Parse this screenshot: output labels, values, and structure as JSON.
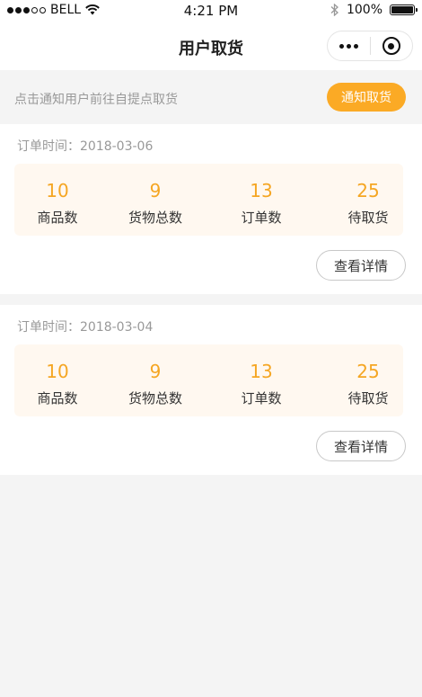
{
  "status_bar": {
    "carrier": "BELL",
    "time": "4:21 PM",
    "battery": "100%",
    "signal_bars": 3,
    "signal_total": 5
  },
  "nav": {
    "title": "用户取货",
    "more_icon": "more-dots-icon",
    "close_icon": "target-icon"
  },
  "notify": {
    "tip": "点击通知用户前往自提点取货",
    "button_label": "通知取货",
    "accent_color": "#fbaa25"
  },
  "orders": [
    {
      "date_label": "订单时间：2018-03-06",
      "stats": [
        {
          "value": "10",
          "label": "商品数"
        },
        {
          "value": "9",
          "label": "货物总数"
        },
        {
          "value": "13",
          "label": "订单数"
        },
        {
          "value": "25",
          "label": "待取货"
        }
      ],
      "detail_label": "查看详情"
    },
    {
      "date_label": "订单时间：2018-03-04",
      "stats": [
        {
          "value": "10",
          "label": "商品数"
        },
        {
          "value": "9",
          "label": "货物总数"
        },
        {
          "value": "13",
          "label": "订单数"
        },
        {
          "value": "25",
          "label": "待取货"
        }
      ],
      "detail_label": "查看详情"
    }
  ]
}
